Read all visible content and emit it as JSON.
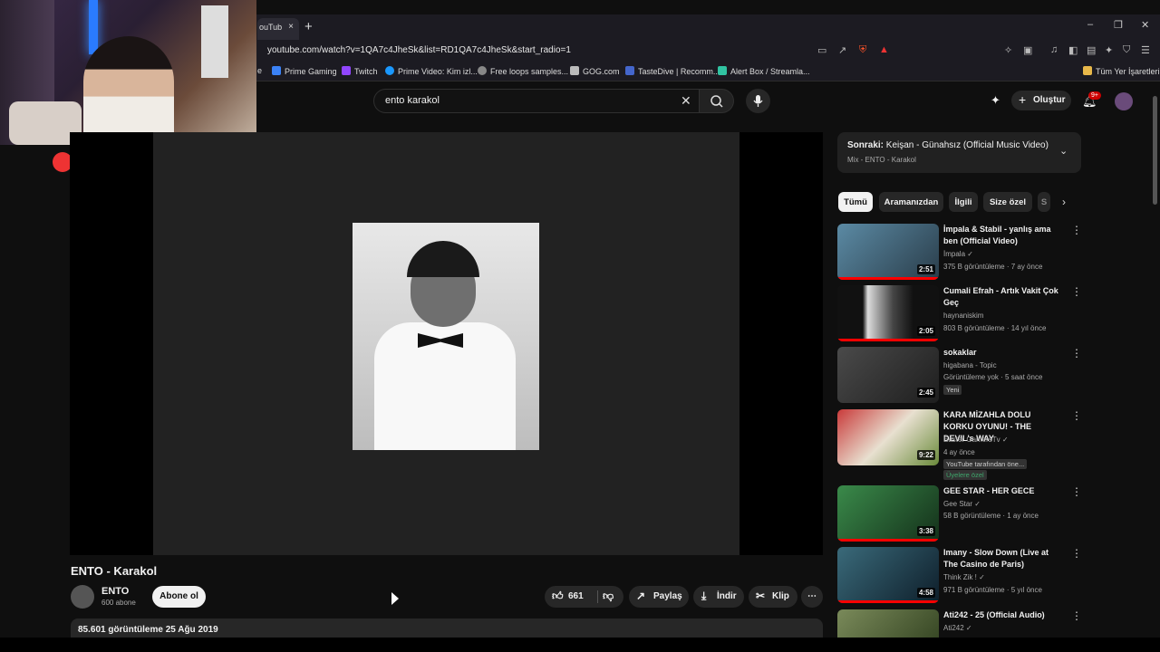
{
  "browser": {
    "tab_title": "ouTub",
    "tab_close": "×",
    "new_tab": "+",
    "window_controls": [
      "–",
      "❐",
      "✕"
    ],
    "url": "youtube.com/watch?v=1QA7c4JheSk&list=RD1QA7c4JheSk&start_radio=1",
    "bookmarks": [
      {
        "label": "e",
        "icon_color": "#777"
      },
      {
        "label": "Prime Gaming",
        "icon_color": "#3b82f6"
      },
      {
        "label": "Twitch",
        "icon_color": "#9146ff"
      },
      {
        "label": "Prime Video: Kim izl...",
        "icon_color": "#1a98ff"
      },
      {
        "label": "Free loops samples...",
        "icon_color": "#888"
      },
      {
        "label": "GOG.com",
        "icon_color": "#bbb"
      },
      {
        "label": "TasteDive | Recomm...",
        "icon_color": "#4466cc"
      },
      {
        "label": "Alert Box / Streamla...",
        "icon_color": "#31c3a2"
      }
    ],
    "all_bookmarks": "Tüm Yer İşaretleri"
  },
  "header": {
    "search_value": "ento karakol",
    "create_label": "Oluştur",
    "notification_count": "9+"
  },
  "video": {
    "title": "ENTO - Karakol",
    "channel_name": "ENTO",
    "channel_subs": "600 abone",
    "subscribe_label": "Abone ol",
    "like_count": "661",
    "share_label": "Paylaş",
    "download_label": "İndir",
    "clip_label": "Klip",
    "more": "⋯",
    "views_date": "85.601 görüntüleme  25 Ağu 2019"
  },
  "up_next": {
    "prefix": "Sonraki:",
    "title": "Keişan - Günahsız (Official Music Video)",
    "subtitle": "Mix - ENTO - Karakol"
  },
  "chips": [
    "Tümü",
    "Aramanızdan",
    "İlgili",
    "Size özel",
    "S"
  ],
  "recommendations": [
    {
      "title": "İmpala & Stabil - yanlış ama ben (Official Video)",
      "channel": "İmpala",
      "verified": true,
      "meta": "375 B görüntüleme · 7 ay önce",
      "duration": "2:51",
      "badge": "",
      "badge2": "",
      "thumb": "#3d6f8a"
    },
    {
      "title": "Cumali Efrah - Artık Vakit Çok Geç",
      "channel": "haynaniskim",
      "verified": false,
      "meta": "803 B görüntüleme · 14 yıl önce",
      "duration": "2:05",
      "badge": "",
      "badge2": "",
      "thumb": "#2a2a2a"
    },
    {
      "title": "sokaklar",
      "channel": "higabana - Topic",
      "verified": false,
      "meta": "Görüntüleme yok · 5 saat önce",
      "duration": "2:45",
      "badge": "Yeni",
      "badge2": "",
      "thumb": "#3a3a3a"
    },
    {
      "title": "KARA MİZAHLA DOLU KORKU OYUNU! - THE DEVIL's WAY",
      "channel": "Easter GamersTv",
      "verified": true,
      "meta": "4 ay önce",
      "duration": "9:22",
      "badge": "YouTube tarafından öne...",
      "badge2": "Üyelere özel",
      "thumb": "#8a2a2a"
    },
    {
      "title": "GEE STAR - HER GECE",
      "channel": "Gee Star",
      "verified": true,
      "meta": "58 B görüntüleme · 1 ay önce",
      "duration": "3:38",
      "badge": "",
      "badge2": "",
      "thumb": "#2f6a3a"
    },
    {
      "title": "Imany - Slow Down (Live at The Casino de Paris)",
      "channel": "Think Zik !",
      "verified": true,
      "meta": "971 B görüntüleme · 5 yıl önce",
      "duration": "4:58",
      "badge": "",
      "badge2": "",
      "thumb": "#2a4a5a"
    },
    {
      "title": "Ati242 - 25 (Official Audio)",
      "channel": "Ati242",
      "verified": true,
      "meta": "",
      "duration": "",
      "badge": "",
      "badge2": "",
      "thumb": "#5a6a3a"
    }
  ]
}
